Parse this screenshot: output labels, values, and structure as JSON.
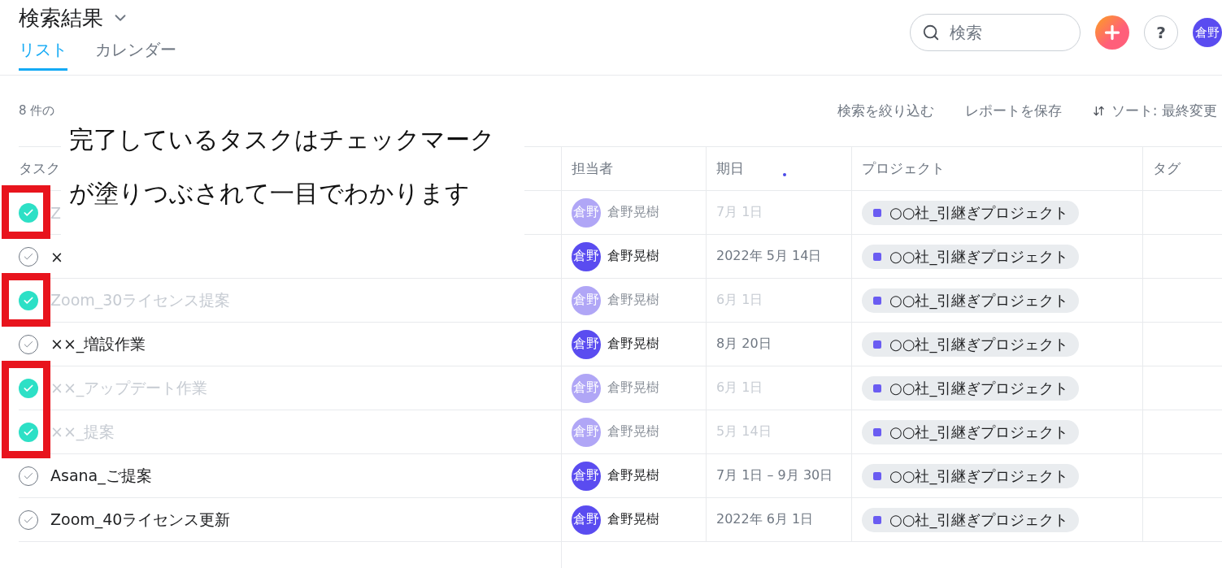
{
  "header": {
    "title": "検索結果",
    "tabs": [
      {
        "label": "リスト",
        "selected": true
      },
      {
        "label": "カレンダー",
        "selected": false
      }
    ],
    "search": {
      "placeholder": "検索"
    },
    "help_button": "?",
    "user_avatar": "倉野"
  },
  "toolbar": {
    "count": "8 件の",
    "actions": [
      "検索を絞り込む",
      "レポートを保存"
    ],
    "sort": "ソート: 最終変更"
  },
  "table": {
    "columns": [
      "タスク",
      "担当者",
      "期日",
      "プロジェクト",
      "タグ"
    ],
    "rows": [
      {
        "task": "Z",
        "completed": true,
        "highlighted": true,
        "avatar": "倉野",
        "assignee": "倉野晃樹",
        "due": "7月 1日",
        "project": {
          "label": "○○社_引継ぎプロジェクト",
          "color": "#6a5cf2"
        }
      },
      {
        "task": "×",
        "completed": false,
        "highlighted": false,
        "avatar": "倉野",
        "assignee": "倉野晃樹",
        "due": "2022年 5月 14日",
        "project": {
          "label": "○○社_引継ぎプロジェクト",
          "color": "#6a5cf2"
        }
      },
      {
        "task": "Zoom_30ライセンス提案",
        "completed": true,
        "highlighted": true,
        "avatar": "倉野",
        "assignee": "倉野晃樹",
        "due": "6月 1日",
        "project": {
          "label": "○○社_引継ぎプロジェクト",
          "color": "#6a5cf2"
        }
      },
      {
        "task": "××_増設作業",
        "completed": false,
        "highlighted": false,
        "avatar": "倉野",
        "assignee": "倉野晃樹",
        "due": "8月 20日",
        "project": {
          "label": "○○社_引継ぎプロジェクト",
          "color": "#6a5cf2"
        }
      },
      {
        "task": "××_アップデート作業",
        "completed": true,
        "highlighted": true,
        "avatar": "倉野",
        "assignee": "倉野晃樹",
        "due": "6月 1日",
        "project": {
          "label": "○○社_引継ぎプロジェクト",
          "color": "#6a5cf2"
        }
      },
      {
        "task": "××_提案",
        "completed": true,
        "highlighted": true,
        "avatar": "倉野",
        "assignee": "倉野晃樹",
        "due": "5月 14日",
        "project": {
          "label": "○○社_引継ぎプロジェクト",
          "color": "#6a5cf2"
        }
      },
      {
        "task": "Asana_ご提案",
        "completed": false,
        "highlighted": false,
        "avatar": "倉野",
        "assignee": "倉野晃樹",
        "due": "7月 1日 – 9月 30日",
        "project": {
          "label": "○○社_引継ぎプロジェクト",
          "color": "#6a5cf2"
        }
      },
      {
        "task": "Zoom_40ライセンス更新",
        "completed": false,
        "highlighted": false,
        "avatar": "倉野",
        "assignee": "倉野晃樹",
        "due": "2022年 6月 1日",
        "project": {
          "label": "○○社_引継ぎプロジェクト",
          "color": "#6a5cf2"
        }
      }
    ]
  },
  "callout": {
    "lines": [
      "完了しているタスクはチェックマーク",
      "が塗りつぶされて一目でわかります"
    ]
  }
}
